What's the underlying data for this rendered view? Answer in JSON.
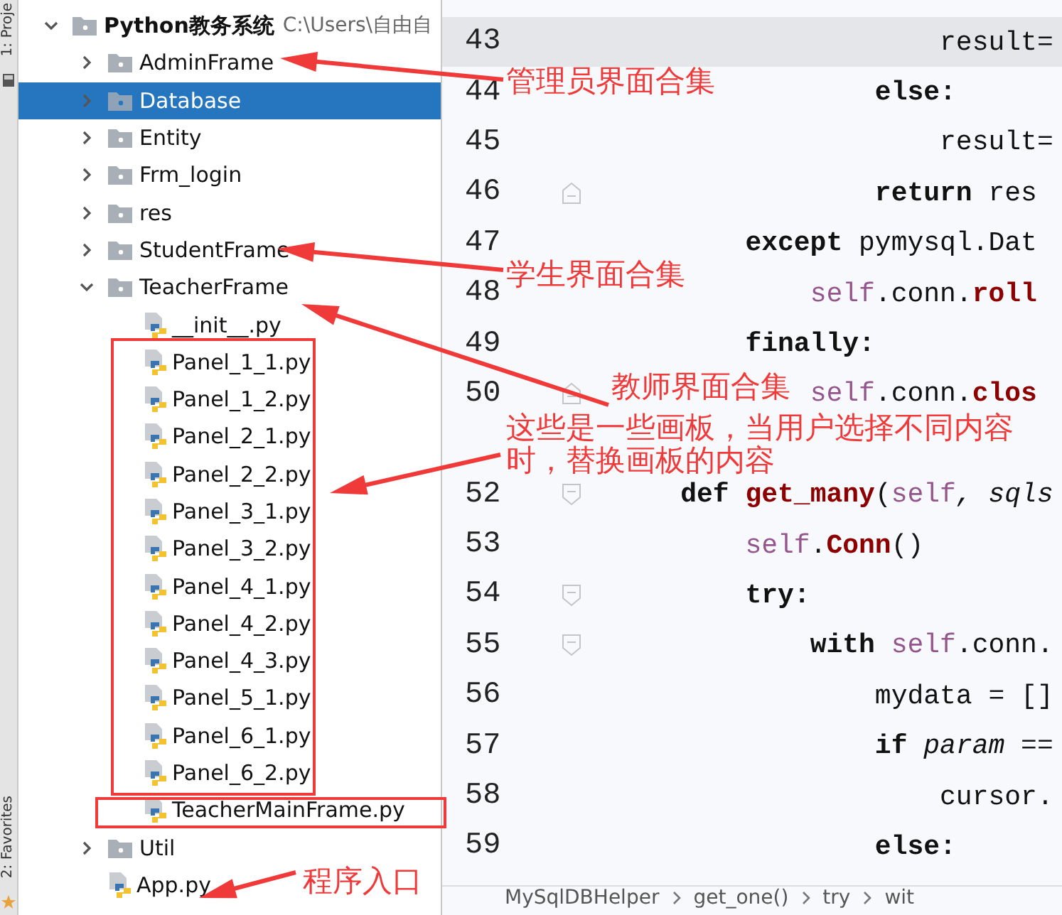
{
  "tool_tabs": [
    {
      "label": "1: Proje"
    },
    {
      "label": "2: Favorites"
    }
  ],
  "project_tree": {
    "name": "Python教务系统",
    "path": "C:\\Users\\自由自",
    "kind": "folder",
    "expanded": true,
    "selected": false,
    "children": [
      {
        "name": "AdminFrame",
        "kind": "folder",
        "expanded": false,
        "selected": false
      },
      {
        "name": "Database",
        "kind": "folder",
        "expanded": false,
        "selected": true
      },
      {
        "name": "Entity",
        "kind": "folder",
        "expanded": false,
        "selected": false
      },
      {
        "name": "Frm_login",
        "kind": "folder",
        "expanded": false,
        "selected": false
      },
      {
        "name": "res",
        "kind": "folder",
        "expanded": false,
        "selected": false
      },
      {
        "name": "StudentFrame",
        "kind": "folder",
        "expanded": false,
        "selected": false
      },
      {
        "name": "TeacherFrame",
        "kind": "folder",
        "expanded": true,
        "selected": false,
        "children": [
          {
            "name": "__init__.py",
            "kind": "python",
            "selected": false
          },
          {
            "name": "Panel_1_1.py",
            "kind": "python",
            "selected": false
          },
          {
            "name": "Panel_1_2.py",
            "kind": "python",
            "selected": false
          },
          {
            "name": "Panel_2_1.py",
            "kind": "python",
            "selected": false
          },
          {
            "name": "Panel_2_2.py",
            "kind": "python",
            "selected": false
          },
          {
            "name": "Panel_3_1.py",
            "kind": "python",
            "selected": false
          },
          {
            "name": "Panel_3_2.py",
            "kind": "python",
            "selected": false
          },
          {
            "name": "Panel_4_1.py",
            "kind": "python",
            "selected": false
          },
          {
            "name": "Panel_4_2.py",
            "kind": "python",
            "selected": false
          },
          {
            "name": "Panel_4_3.py",
            "kind": "python",
            "selected": false
          },
          {
            "name": "Panel_5_1.py",
            "kind": "python",
            "selected": false
          },
          {
            "name": "Panel_6_1.py",
            "kind": "python",
            "selected": false
          },
          {
            "name": "Panel_6_2.py",
            "kind": "python",
            "selected": false
          },
          {
            "name": "TeacherMainFrame.py",
            "kind": "python",
            "selected": false
          }
        ]
      },
      {
        "name": "Util",
        "kind": "folder",
        "expanded": false,
        "selected": false
      },
      {
        "name": "App.py",
        "kind": "python",
        "selected": false
      }
    ]
  },
  "editor": {
    "lines": [
      {
        "number": "43",
        "current": true,
        "tokens": [
          {
            "t": "                    result=",
            "kind": "plain"
          }
        ]
      },
      {
        "number": "44",
        "current": false,
        "tokens": [
          {
            "t": "                else:",
            "kind": "keyword"
          }
        ]
      },
      {
        "number": "45",
        "current": false,
        "tokens": [
          {
            "t": "                    result=",
            "kind": "plain"
          }
        ]
      },
      {
        "number": "46",
        "current": false,
        "fold": {
          "kind": "end"
        },
        "tokens": [
          {
            "t": "                return",
            "kind": "keyword"
          },
          {
            "t": " res",
            "kind": "plain"
          }
        ]
      },
      {
        "number": "47",
        "current": false,
        "tokens": [
          {
            "t": "        except",
            "kind": "keyword"
          },
          {
            "t": " pymysql.Dat",
            "kind": "plain"
          }
        ]
      },
      {
        "number": "48",
        "current": false,
        "tokens": [
          {
            "t": "            self",
            "kind": "self"
          },
          {
            "t": ".conn.",
            "kind": "plain"
          },
          {
            "t": "roll",
            "kind": "method"
          }
        ]
      },
      {
        "number": "49",
        "current": false,
        "tokens": [
          {
            "t": "        finally:",
            "kind": "keyword"
          }
        ]
      },
      {
        "number": "50",
        "current": false,
        "fold": {
          "kind": "end"
        },
        "tokens": [
          {
            "t": "            self",
            "kind": "self"
          },
          {
            "t": ".conn.",
            "kind": "plain"
          },
          {
            "t": "clos",
            "kind": "method"
          }
        ]
      },
      {
        "current": false
      },
      {
        "number": "52",
        "current": false,
        "fold": {
          "kind": "start"
        },
        "tokens": [
          {
            "t": "    def",
            "kind": "keyword"
          },
          {
            "t": " get_many",
            "kind": "method"
          },
          {
            "t": "(",
            "kind": "plain"
          },
          {
            "t": "self",
            "kind": "self"
          },
          {
            "t": ", sqls",
            "kind": "param"
          }
        ]
      },
      {
        "number": "53",
        "current": false,
        "tokens": [
          {
            "t": "        self",
            "kind": "self"
          },
          {
            "t": ".",
            "kind": "plain"
          },
          {
            "t": "Conn",
            "kind": "method"
          },
          {
            "t": "()",
            "kind": "plain"
          }
        ]
      },
      {
        "number": "54",
        "current": false,
        "fold": {
          "kind": "start"
        },
        "tokens": [
          {
            "t": "        try:",
            "kind": "keyword"
          }
        ]
      },
      {
        "number": "55",
        "current": false,
        "fold": {
          "kind": "start"
        },
        "tokens": [
          {
            "t": "            with",
            "kind": "keyword"
          },
          {
            "t": " self",
            "kind": "self"
          },
          {
            "t": ".conn.",
            "kind": "plain"
          }
        ]
      },
      {
        "number": "56",
        "current": false,
        "tokens": [
          {
            "t": "                mydata = []",
            "kind": "plain"
          }
        ]
      },
      {
        "number": "57",
        "current": false,
        "tokens": [
          {
            "t": "                if",
            "kind": "keyword"
          },
          {
            "t": " param",
            "kind": "param"
          },
          {
            "t": " ==",
            "kind": "plain"
          }
        ]
      },
      {
        "number": "58",
        "current": false,
        "tokens": [
          {
            "t": "                    cursor.",
            "kind": "plain"
          }
        ]
      },
      {
        "number": "59",
        "current": false,
        "tokens": [
          {
            "t": "                else:",
            "kind": "keyword"
          }
        ]
      }
    ],
    "breadcrumbs": [
      "MySqlDBHelper",
      "get_one()",
      "try",
      "wit"
    ]
  },
  "annotations": [
    "管理员界面合集",
    "学生界面合集",
    "教师界面合集",
    "这些是一些画板，当用户选择不同内容时，替换画板的内容",
    "程序入口"
  ]
}
